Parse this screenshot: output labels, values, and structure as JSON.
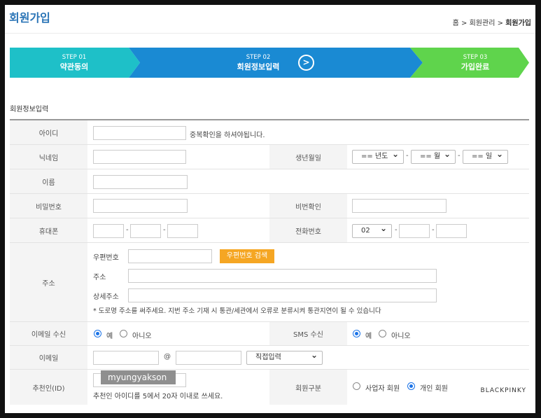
{
  "header": {
    "title": "회원가입",
    "breadcrumb": {
      "home": "홈",
      "sep1": ">",
      "parent": "회원관리",
      "sep2": ">",
      "current": "회원가입"
    }
  },
  "steps": [
    {
      "num": "STEP 01",
      "label": "약관동의",
      "color": "#1ec0c8"
    },
    {
      "num": "STEP 02",
      "label": "회원정보입력",
      "color": "#1a8ad3",
      "arrow": ">"
    },
    {
      "num": "STEP 03",
      "label": "가입완료",
      "color": "#5fd44c"
    }
  ],
  "section_title": "회원정보입력",
  "form": {
    "id": {
      "label": "아이디",
      "hint": "중복확인을 하셔야됩니다."
    },
    "nickname": {
      "label": "닉네임"
    },
    "birth": {
      "label": "생년월일",
      "year": "== 년도",
      "month": "== 월",
      "day": "== 일",
      "dash": "-"
    },
    "name": {
      "label": "이름"
    },
    "password": {
      "label": "비밀번호"
    },
    "password_confirm": {
      "label": "비번확인"
    },
    "mobile": {
      "label": "휴대폰",
      "dash": "-"
    },
    "phone": {
      "label": "전화번호",
      "area": "02",
      "dash": "-"
    },
    "address": {
      "label": "주소",
      "zip_label": "우편번호",
      "zip_button": "우편번호 검색",
      "addr_label": "주소",
      "detail_label": "상세주소",
      "note": "* 도로명 주소를 써주세요. 지번 주소 기재 시 통관/세관에서 오류로 분류시켜 통관지연이 될 수 있습니다"
    },
    "email_recv": {
      "label": "이메일 수신",
      "yes": "예",
      "no": "아니오"
    },
    "sms_recv": {
      "label": "SMS 수신",
      "yes": "예",
      "no": "아니오"
    },
    "email": {
      "label": "이메일",
      "at": "@",
      "domain_select": "직접입력"
    },
    "referrer": {
      "label": "추천인(ID)",
      "note": "추천인 아이디를 5에서 20자 이내로 쓰세요."
    },
    "member_type": {
      "label": "회원구분",
      "business": "사업자 회원",
      "personal": "개인 회원"
    }
  },
  "watermarks": {
    "left": "myungyakson",
    "right": "BLACKPINKY"
  }
}
